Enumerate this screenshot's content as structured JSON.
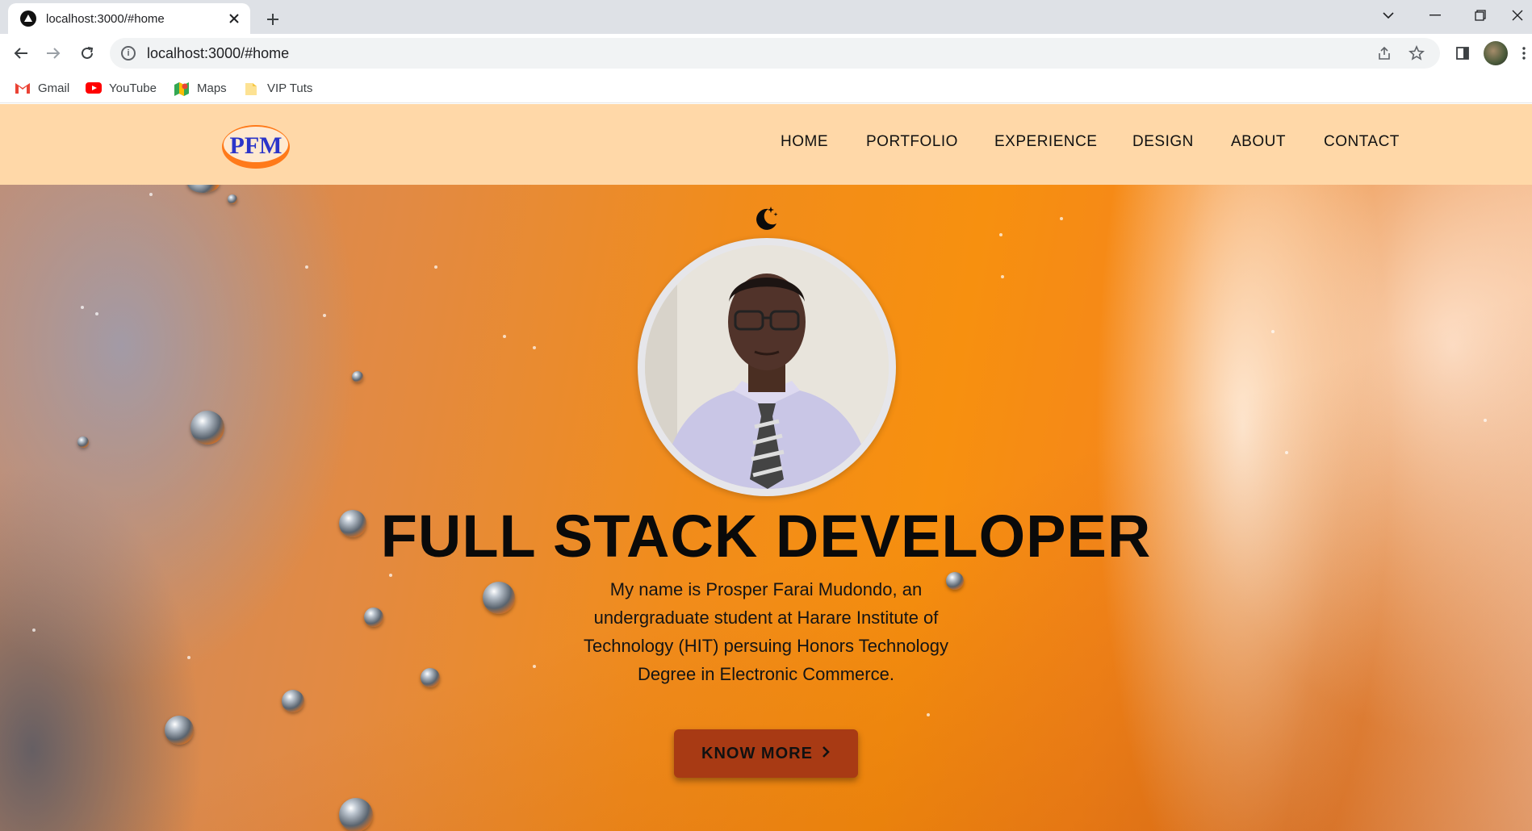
{
  "browser": {
    "tab_title": "localhost:3000/#home",
    "url": "localhost:3000/#home",
    "bookmarks": [
      {
        "label": "Gmail",
        "icon": "gmail-icon"
      },
      {
        "label": "YouTube",
        "icon": "youtube-icon"
      },
      {
        "label": "Maps",
        "icon": "maps-icon"
      },
      {
        "label": "VIP Tuts",
        "icon": "folder-icon"
      }
    ]
  },
  "site": {
    "logo_text": "PFM",
    "nav": [
      {
        "label": "HOME"
      },
      {
        "label": "PORTFOLIO"
      },
      {
        "label": "EXPERIENCE"
      },
      {
        "label": "DESIGN"
      },
      {
        "label": "ABOUT"
      },
      {
        "label": "CONTACT"
      }
    ],
    "hero": {
      "title": "FULL STACK DEVELOPER",
      "description": "My name is Prosper Farai Mudondo, an undergraduate student at Harare Institute of Technology (HIT) persuing Honors Technology Degree in Electronic Commerce.",
      "cta_label": "KNOW MORE",
      "cta_icon": "chevron-right-icon",
      "theme_toggle_icon": "moon-stars-icon"
    }
  },
  "colors": {
    "header_bg": "#ffd8a8",
    "hero_orange": "#f18c1b",
    "cta_bg": "#a83a14",
    "title_text": "#0a0a0a"
  }
}
